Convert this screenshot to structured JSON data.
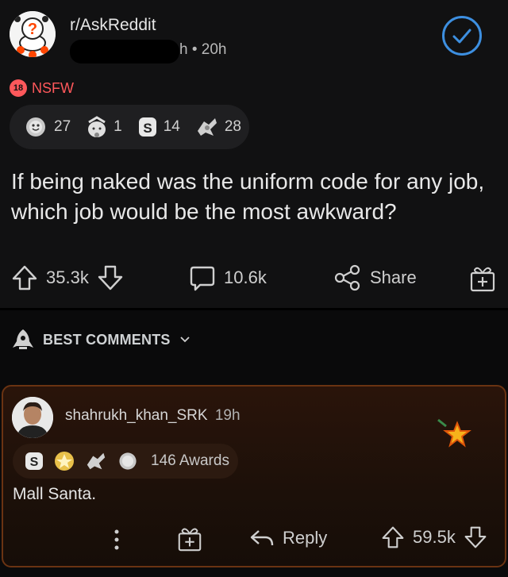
{
  "post": {
    "subreddit": "r/AskReddit",
    "meta_suffix": "h • 20h",
    "nsfw_badge": "18",
    "nsfw_label": "NSFW",
    "awards": [
      {
        "icon": "silver-award-icon",
        "count": "27"
      },
      {
        "icon": "helpful-award-icon",
        "count": "1"
      },
      {
        "icon": "coin-award-icon",
        "count": "14"
      },
      {
        "icon": "wholesome-seal-award-icon",
        "count": "28"
      }
    ],
    "title": "If being naked was the uniform code for any job, which job would be the most awkward?",
    "upvotes": "35.3k",
    "comments": "10.6k",
    "share_label": "Share"
  },
  "sort": {
    "label": "BEST COMMENTS"
  },
  "comment": {
    "author": "shahrukh_khan_SRK",
    "time": "19h",
    "awards_count": "146 Awards",
    "body": "Mall Santa.",
    "reply_label": "Reply",
    "score": "59.5k"
  },
  "colors": {
    "accent_blue": "#3d8fe0",
    "nsfw_red": "#ff585b",
    "comment_border": "#6a3312"
  }
}
